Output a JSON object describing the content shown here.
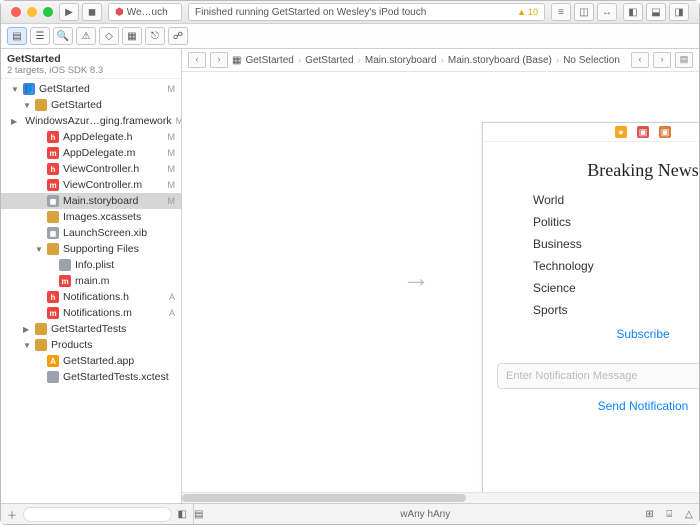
{
  "titlebar": {
    "tab_title": "We…uch",
    "status": "Finished running GetStarted on Wesley's iPod touch",
    "warning_count": "10"
  },
  "project": {
    "name": "GetStarted",
    "subtitle": "2 targets, iOS SDK 8.3"
  },
  "tree": [
    {
      "d": 0,
      "tri": "o",
      "icon": "📘",
      "iclass": "bg-blue",
      "label": "GetStarted",
      "m": "M"
    },
    {
      "d": 1,
      "tri": "o",
      "icon": "",
      "iclass": "bg-folder",
      "label": "GetStarted",
      "m": ""
    },
    {
      "d": 2,
      "tri": "c",
      "icon": "",
      "iclass": "bg-folder",
      "label": "WindowsAzur…ging.framework",
      "m": "M"
    },
    {
      "d": 2,
      "tri": "n",
      "icon": "h",
      "iclass": "bg-red",
      "label": "AppDelegate.h",
      "m": "M"
    },
    {
      "d": 2,
      "tri": "n",
      "icon": "m",
      "iclass": "bg-red",
      "label": "AppDelegate.m",
      "m": "M"
    },
    {
      "d": 2,
      "tri": "n",
      "icon": "h",
      "iclass": "bg-red",
      "label": "ViewController.h",
      "m": "M"
    },
    {
      "d": 2,
      "tri": "n",
      "icon": "m",
      "iclass": "bg-red",
      "label": "ViewController.m",
      "m": "M"
    },
    {
      "d": 2,
      "tri": "n",
      "icon": "◼",
      "iclass": "bg-gray",
      "label": "Main.storyboard",
      "m": "M",
      "sel": true
    },
    {
      "d": 2,
      "tri": "n",
      "icon": "",
      "iclass": "bg-folder",
      "label": "Images.xcassets",
      "m": ""
    },
    {
      "d": 2,
      "tri": "n",
      "icon": "◼",
      "iclass": "bg-gray",
      "label": "LaunchScreen.xib",
      "m": ""
    },
    {
      "d": 2,
      "tri": "o",
      "icon": "",
      "iclass": "bg-folder",
      "label": "Supporting Files",
      "m": ""
    },
    {
      "d": 3,
      "tri": "n",
      "icon": "",
      "iclass": "bg-gray",
      "label": "Info.plist",
      "m": ""
    },
    {
      "d": 3,
      "tri": "n",
      "icon": "m",
      "iclass": "bg-red",
      "label": "main.m",
      "m": ""
    },
    {
      "d": 2,
      "tri": "n",
      "icon": "h",
      "iclass": "bg-red",
      "label": "Notifications.h",
      "m": "A"
    },
    {
      "d": 2,
      "tri": "n",
      "icon": "m",
      "iclass": "bg-red",
      "label": "Notifications.m",
      "m": "A"
    },
    {
      "d": 1,
      "tri": "c",
      "icon": "",
      "iclass": "bg-folder",
      "label": "GetStartedTests",
      "m": ""
    },
    {
      "d": 1,
      "tri": "o",
      "icon": "",
      "iclass": "bg-folder",
      "label": "Products",
      "m": ""
    },
    {
      "d": 2,
      "tri": "n",
      "icon": "A",
      "iclass": "bg-org",
      "label": "GetStarted.app",
      "m": ""
    },
    {
      "d": 2,
      "tri": "n",
      "icon": "",
      "iclass": "bg-gray",
      "label": "GetStartedTests.xctest",
      "m": ""
    }
  ],
  "jumpbar": [
    "GetStarted",
    "GetStarted",
    "Main.storyboard",
    "Main.storyboard (Base)",
    "No Selection"
  ],
  "scene": {
    "title": "Breaking News",
    "items": [
      "World",
      "Politics",
      "Business",
      "Technology",
      "Science",
      "Sports"
    ],
    "subscribe": "Subscribe",
    "placeholder": "Enter Notification Message",
    "send": "Send Notification"
  },
  "footer": {
    "size": "wAny hAny"
  }
}
